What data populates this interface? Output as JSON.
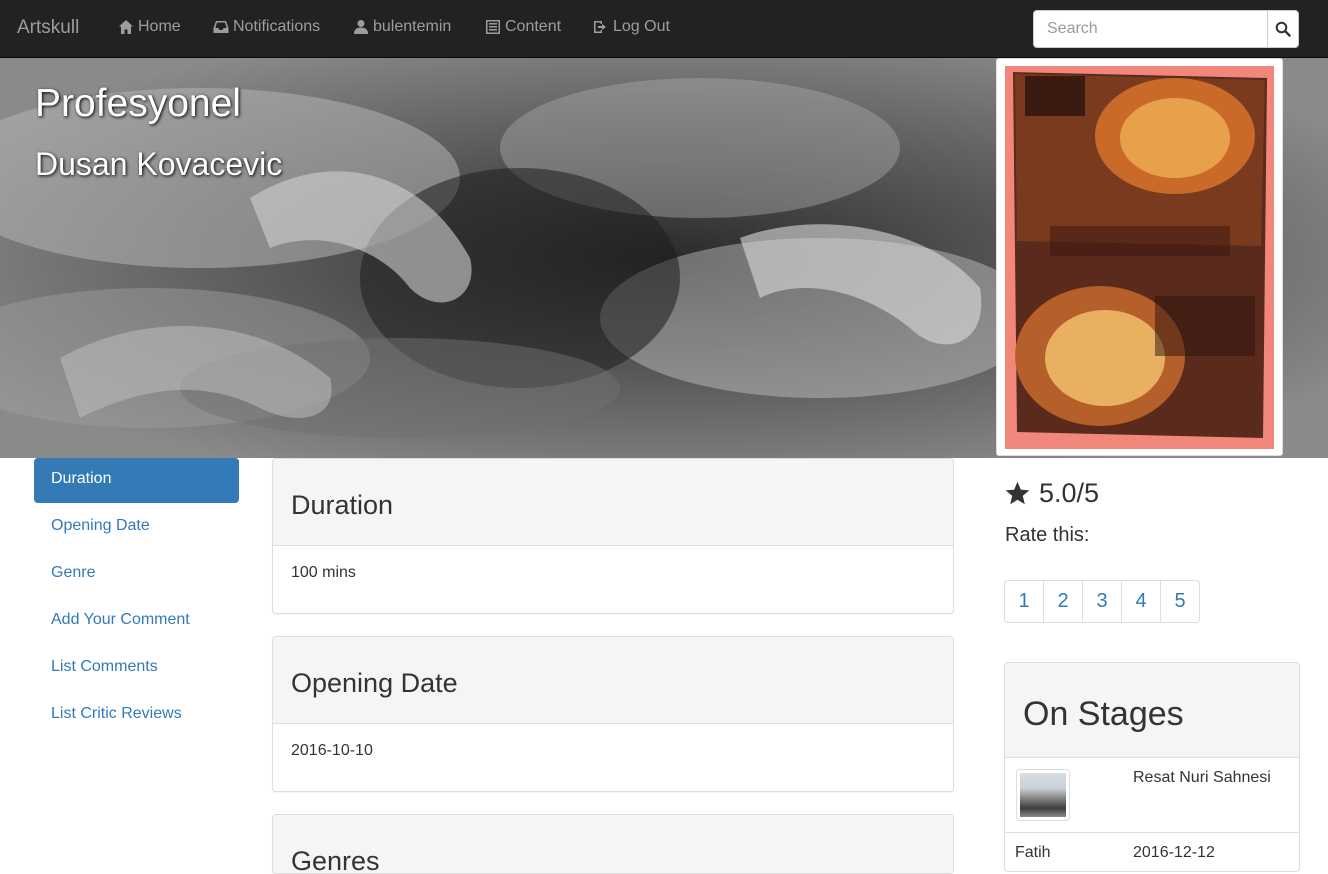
{
  "navbar": {
    "brand": "Artskull",
    "items": [
      {
        "label": "Home",
        "icon": "home-icon"
      },
      {
        "label": "Notifications",
        "icon": "inbox-icon"
      },
      {
        "label": "bulentemin",
        "icon": "user-icon"
      },
      {
        "label": "Content",
        "icon": "list-icon"
      },
      {
        "label": "Log Out",
        "icon": "logout-icon"
      }
    ],
    "search_placeholder": "Search"
  },
  "hero": {
    "title": "Profesyonel",
    "subtitle": "Dusan Kovacevic"
  },
  "sidebar": {
    "items": [
      {
        "label": "Duration",
        "active": true
      },
      {
        "label": "Opening Date",
        "active": false
      },
      {
        "label": "Genre",
        "active": false
      },
      {
        "label": "Add Your Comment",
        "active": false
      },
      {
        "label": "List Comments",
        "active": false
      },
      {
        "label": "List Critic Reviews",
        "active": false
      }
    ]
  },
  "panels": {
    "duration": {
      "heading": "Duration",
      "body": "100 mins"
    },
    "opening_date": {
      "heading": "Opening Date",
      "body": "2016-10-10"
    },
    "genres": {
      "heading": "Genres"
    }
  },
  "rating": {
    "score": "5.0/5",
    "rate_label": "Rate this:",
    "options": [
      "1",
      "2",
      "3",
      "4",
      "5"
    ]
  },
  "stages": {
    "heading": "On Stages",
    "items": [
      {
        "name": "Resat Nuri Sahnesi",
        "district": "Fatih",
        "date": "2016-12-12"
      }
    ]
  },
  "colors": {
    "navbar_bg": "#222222",
    "link": "#337ab7",
    "active_bg": "#337ab7",
    "poster_bg": "#f0877a"
  }
}
